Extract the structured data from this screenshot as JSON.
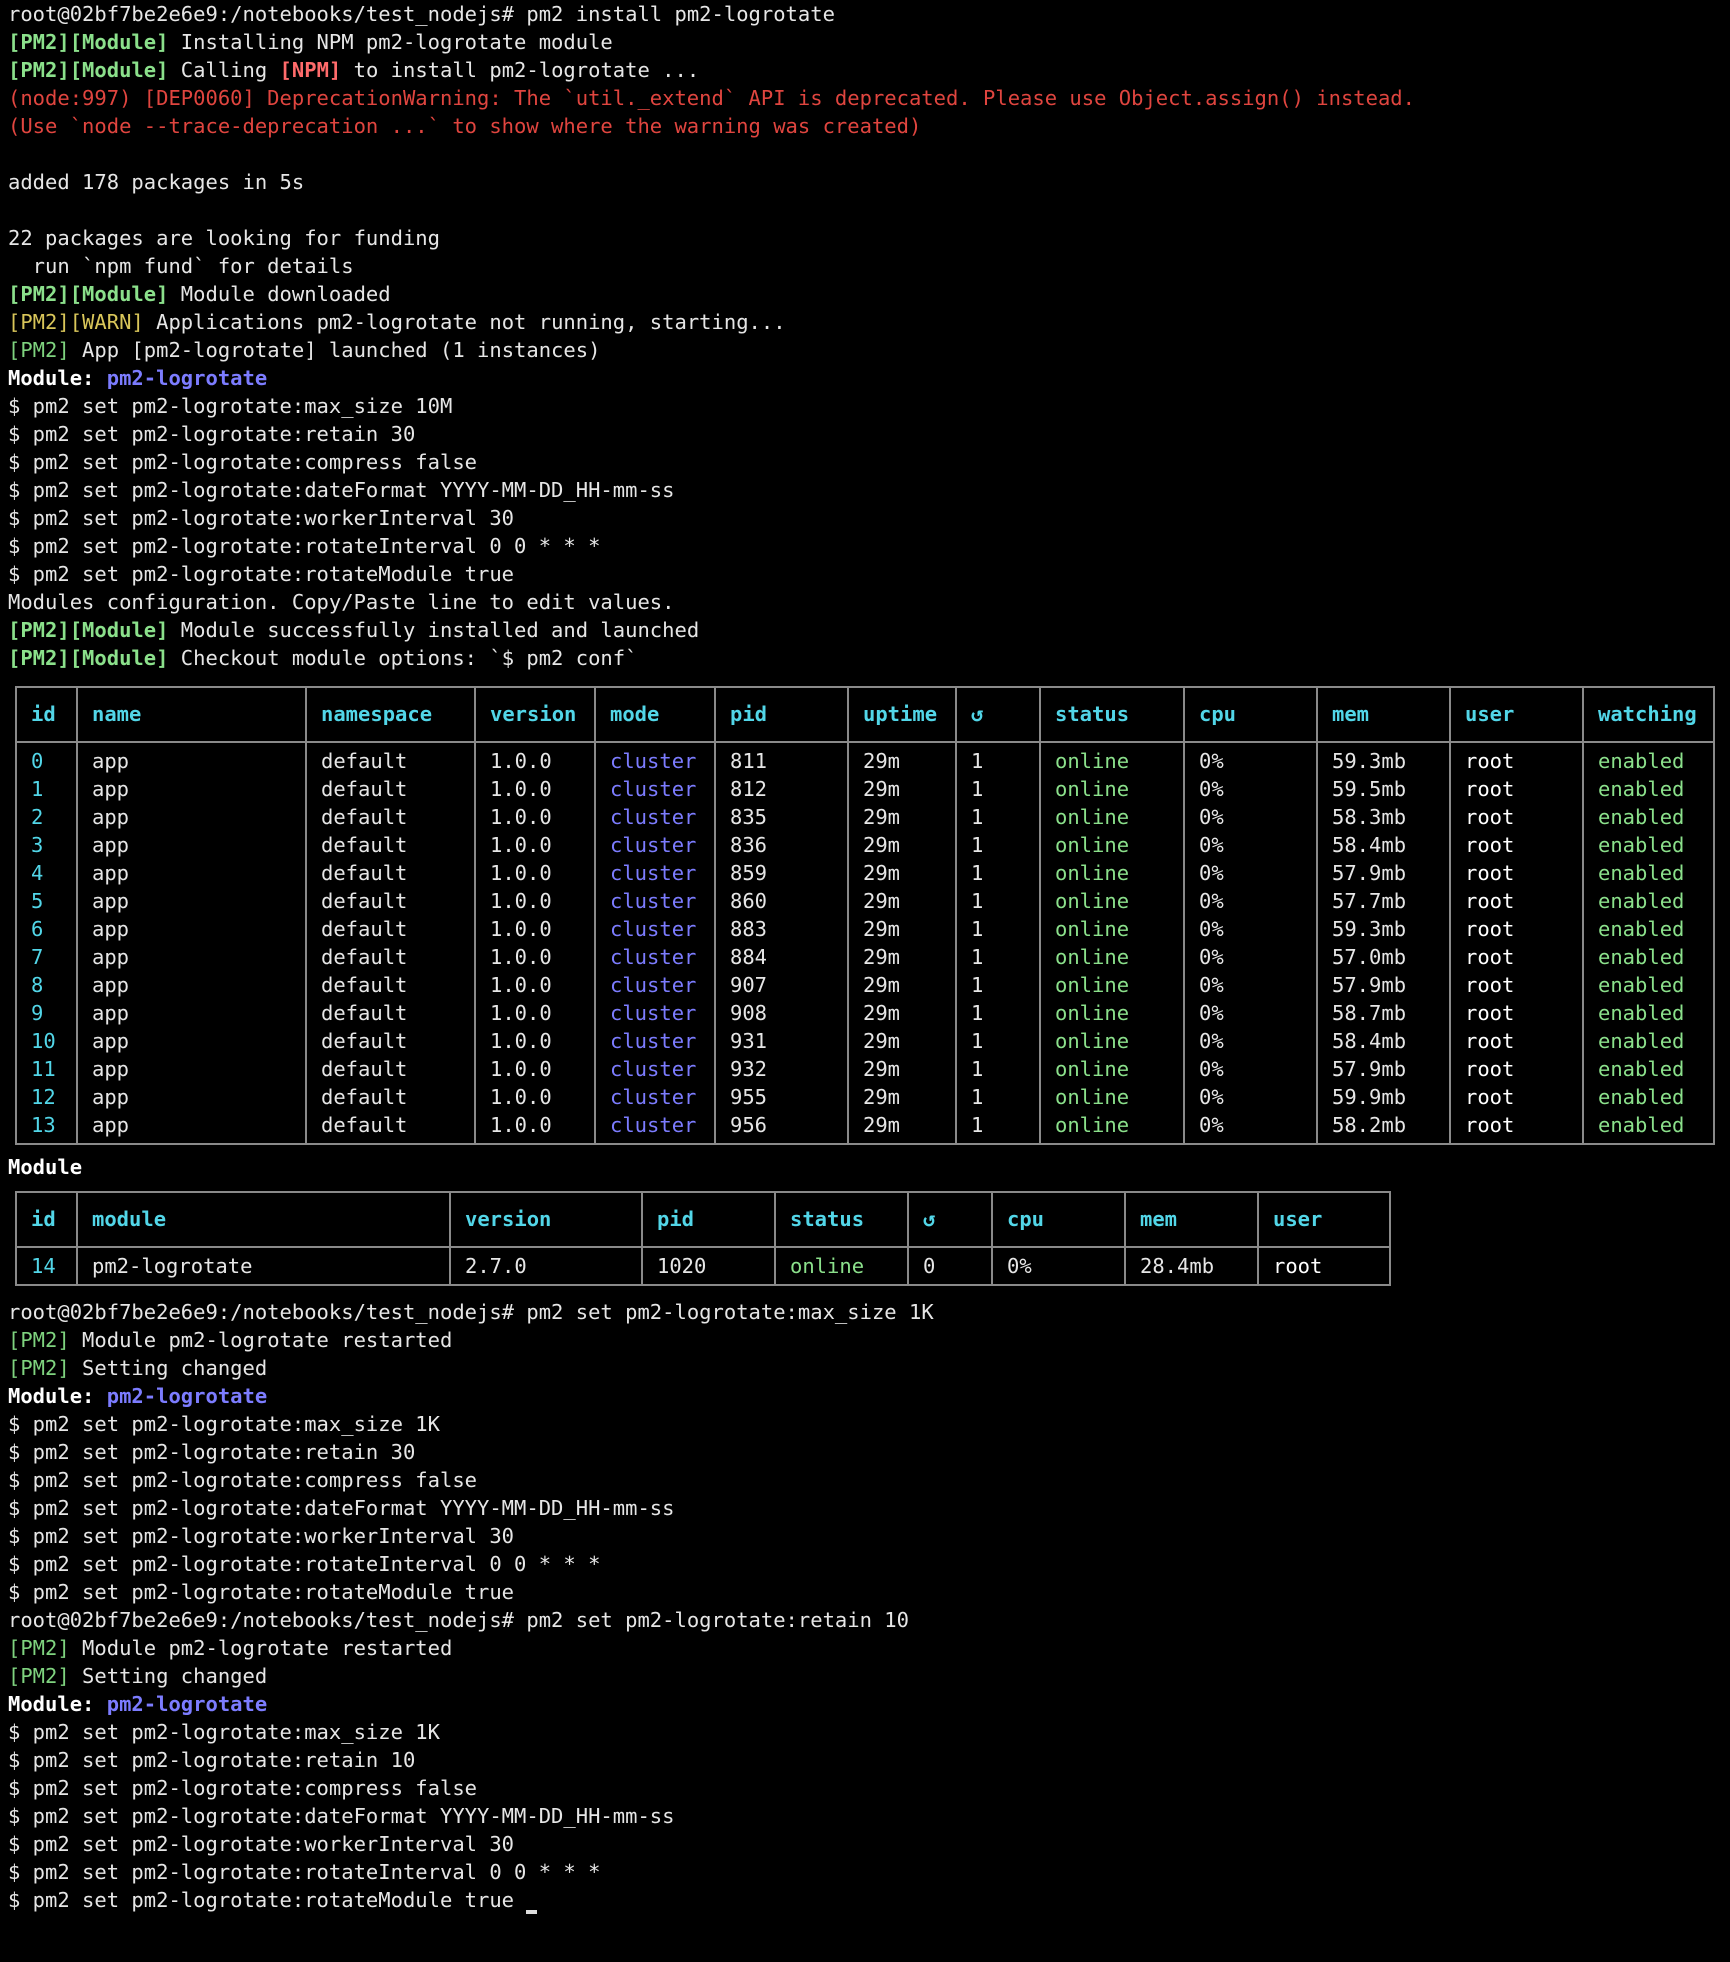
{
  "prompt": "root@02bf7be2e6e9:/notebooks/test_nodejs#",
  "cmd1": "pm2 install pm2-logrotate",
  "install": {
    "pm2_module": "[PM2][Module]",
    "pm2_warn_a": "[PM2]",
    "pm2_warn_b": "[WARN]",
    "pm2": "[PM2]",
    "npm": "[NPM]",
    "l1": " Installing NPM pm2-logrotate module",
    "l2a": " Calling ",
    "l2b": " to install pm2-logrotate ...",
    "dep1": "(node:997) [DEP0060] DeprecationWarning: The `util._extend` API is deprecated. Please use Object.assign() instead.",
    "dep2": "(Use `node --trace-deprecation ...` to show where the warning was created)",
    "added": "added 178 packages in 5s",
    "funding": "22 packages are looking for funding",
    "fund_cmd": "  run `npm fund` for details",
    "downloaded": " Module downloaded",
    "warn": " Applications pm2-logrotate not running, starting...",
    "launched": " App [pm2-logrotate] launched (1 instances)",
    "modules_cfg": "Modules configuration. Copy/Paste line to edit values.",
    "installed": " Module successfully installed and launched",
    "checkout": " Checkout module options: `$ pm2 conf`"
  },
  "module_label": "Module:",
  "module_name": "pm2-logrotate",
  "config1": [
    "$ pm2 set pm2-logrotate:max_size 10M",
    "$ pm2 set pm2-logrotate:retain 30",
    "$ pm2 set pm2-logrotate:compress false",
    "$ pm2 set pm2-logrotate:dateFormat YYYY-MM-DD_HH-mm-ss",
    "$ pm2 set pm2-logrotate:workerInterval 30",
    "$ pm2 set pm2-logrotate:rotateInterval 0 0 * * *",
    "$ pm2 set pm2-logrotate:rotateModule true"
  ],
  "apps_table": {
    "headers": [
      "id",
      "name",
      "namespace",
      "version",
      "mode",
      "pid",
      "uptime",
      "↺",
      "status",
      "cpu",
      "mem",
      "user",
      "watching"
    ],
    "rows": [
      [
        "0",
        "app",
        "default",
        "1.0.0",
        "cluster",
        "811",
        "29m",
        "1",
        "online",
        "0%",
        "59.3mb",
        "root",
        "enabled"
      ],
      [
        "1",
        "app",
        "default",
        "1.0.0",
        "cluster",
        "812",
        "29m",
        "1",
        "online",
        "0%",
        "59.5mb",
        "root",
        "enabled"
      ],
      [
        "2",
        "app",
        "default",
        "1.0.0",
        "cluster",
        "835",
        "29m",
        "1",
        "online",
        "0%",
        "58.3mb",
        "root",
        "enabled"
      ],
      [
        "3",
        "app",
        "default",
        "1.0.0",
        "cluster",
        "836",
        "29m",
        "1",
        "online",
        "0%",
        "58.4mb",
        "root",
        "enabled"
      ],
      [
        "4",
        "app",
        "default",
        "1.0.0",
        "cluster",
        "859",
        "29m",
        "1",
        "online",
        "0%",
        "57.9mb",
        "root",
        "enabled"
      ],
      [
        "5",
        "app",
        "default",
        "1.0.0",
        "cluster",
        "860",
        "29m",
        "1",
        "online",
        "0%",
        "57.7mb",
        "root",
        "enabled"
      ],
      [
        "6",
        "app",
        "default",
        "1.0.0",
        "cluster",
        "883",
        "29m",
        "1",
        "online",
        "0%",
        "59.3mb",
        "root",
        "enabled"
      ],
      [
        "7",
        "app",
        "default",
        "1.0.0",
        "cluster",
        "884",
        "29m",
        "1",
        "online",
        "0%",
        "57.0mb",
        "root",
        "enabled"
      ],
      [
        "8",
        "app",
        "default",
        "1.0.0",
        "cluster",
        "907",
        "29m",
        "1",
        "online",
        "0%",
        "57.9mb",
        "root",
        "enabled"
      ],
      [
        "9",
        "app",
        "default",
        "1.0.0",
        "cluster",
        "908",
        "29m",
        "1",
        "online",
        "0%",
        "58.7mb",
        "root",
        "enabled"
      ],
      [
        "10",
        "app",
        "default",
        "1.0.0",
        "cluster",
        "931",
        "29m",
        "1",
        "online",
        "0%",
        "58.4mb",
        "root",
        "enabled"
      ],
      [
        "11",
        "app",
        "default",
        "1.0.0",
        "cluster",
        "932",
        "29m",
        "1",
        "online",
        "0%",
        "57.9mb",
        "root",
        "enabled"
      ],
      [
        "12",
        "app",
        "default",
        "1.0.0",
        "cluster",
        "955",
        "29m",
        "1",
        "online",
        "0%",
        "59.9mb",
        "root",
        "enabled"
      ],
      [
        "13",
        "app",
        "default",
        "1.0.0",
        "cluster",
        "956",
        "29m",
        "1",
        "online",
        "0%",
        "58.2mb",
        "root",
        "enabled"
      ]
    ]
  },
  "module_section_title": "Module",
  "module_table": {
    "headers": [
      "id",
      "module",
      "version",
      "pid",
      "status",
      "↺",
      "cpu",
      "mem",
      "user"
    ],
    "rows": [
      [
        "14",
        "pm2-logrotate",
        "2.7.0",
        "1020",
        "online",
        "0",
        "0%",
        "28.4mb",
        "root"
      ]
    ]
  },
  "cmd2": "pm2 set pm2-logrotate:max_size 1K",
  "restarted": " Module pm2-logrotate restarted",
  "setting_changed": " Setting changed",
  "config2": [
    "$ pm2 set pm2-logrotate:max_size 1K",
    "$ pm2 set pm2-logrotate:retain 30",
    "$ pm2 set pm2-logrotate:compress false",
    "$ pm2 set pm2-logrotate:dateFormat YYYY-MM-DD_HH-mm-ss",
    "$ pm2 set pm2-logrotate:workerInterval 30",
    "$ pm2 set pm2-logrotate:rotateInterval 0 0 * * *",
    "$ pm2 set pm2-logrotate:rotateModule true"
  ],
  "cmd3": "pm2 set pm2-logrotate:retain 10",
  "config3": [
    "$ pm2 set pm2-logrotate:max_size 1K",
    "$ pm2 set pm2-logrotate:retain 10",
    "$ pm2 set pm2-logrotate:compress false",
    "$ pm2 set pm2-logrotate:dateFormat YYYY-MM-DD_HH-mm-ss",
    "$ pm2 set pm2-logrotate:workerInterval 30",
    "$ pm2 set pm2-logrotate:rotateInterval 0 0 * * *",
    "$ pm2 set pm2-logrotate:rotateModule true"
  ]
}
